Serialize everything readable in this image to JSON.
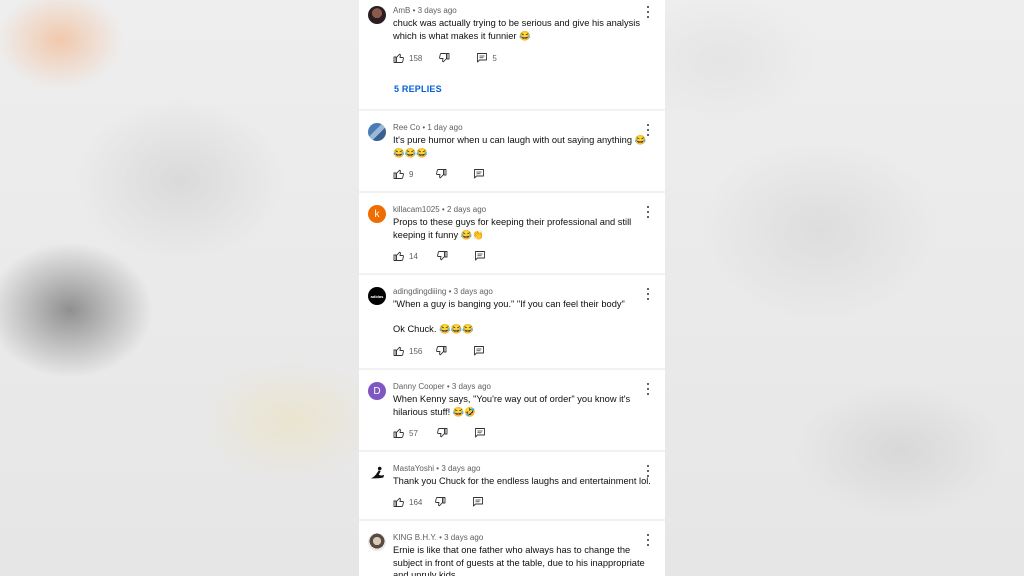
{
  "colors": {
    "link": "#065fd4",
    "avatar_k": "#ef6c00",
    "avatar_d": "#7e57c2"
  },
  "comments": [
    {
      "author": "AmB",
      "time": "3 days ago",
      "avatar_icon": "photo-avatar",
      "text": "chuck was actually trying to be serious and give his analysis which is what makes it funnier 😂",
      "likes": "158",
      "reply_count": "5",
      "replies_link": "5 REPLIES"
    },
    {
      "author": "Ree Co",
      "time": "1 day ago",
      "avatar_icon": "photo-avatar",
      "text": "It's pure humor when u can laugh with out saying anything 😂😂😂😂",
      "likes": "9"
    },
    {
      "author": "killacam1025",
      "time": "2 days ago",
      "avatar_letter": "k",
      "text": "Props to these guys for keeping their professional and still keeping it funny 😂👏",
      "likes": "14"
    },
    {
      "author": "adingdingdiiing",
      "time": "3 days ago",
      "avatar_icon": "adidas-logo-avatar",
      "avatar_text": "adidas",
      "text": "\"When a guy is banging you.\" \"If you can feel their body\"\n\nOk Chuck. 😂😂😂",
      "likes": "156"
    },
    {
      "author": "Danny Cooper",
      "time": "3 days ago",
      "avatar_letter": "D",
      "text": "When Kenny says, \"You're way out of order\" you know it's hilarious stuff! 😂🤣",
      "likes": "57"
    },
    {
      "author": "MastaYoshi",
      "time": "3 days ago",
      "avatar_icon": "character-avatar",
      "text": "Thank you Chuck for the endless laughs and entertainment lol.",
      "likes": "164"
    },
    {
      "author": "KING B.H.Y.",
      "time": "3 days ago",
      "avatar_icon": "photo-avatar",
      "text": "Ernie is like that one father who always has to change the subject in front of guests at the table, due to his inappropriate and unruly kids."
    }
  ]
}
